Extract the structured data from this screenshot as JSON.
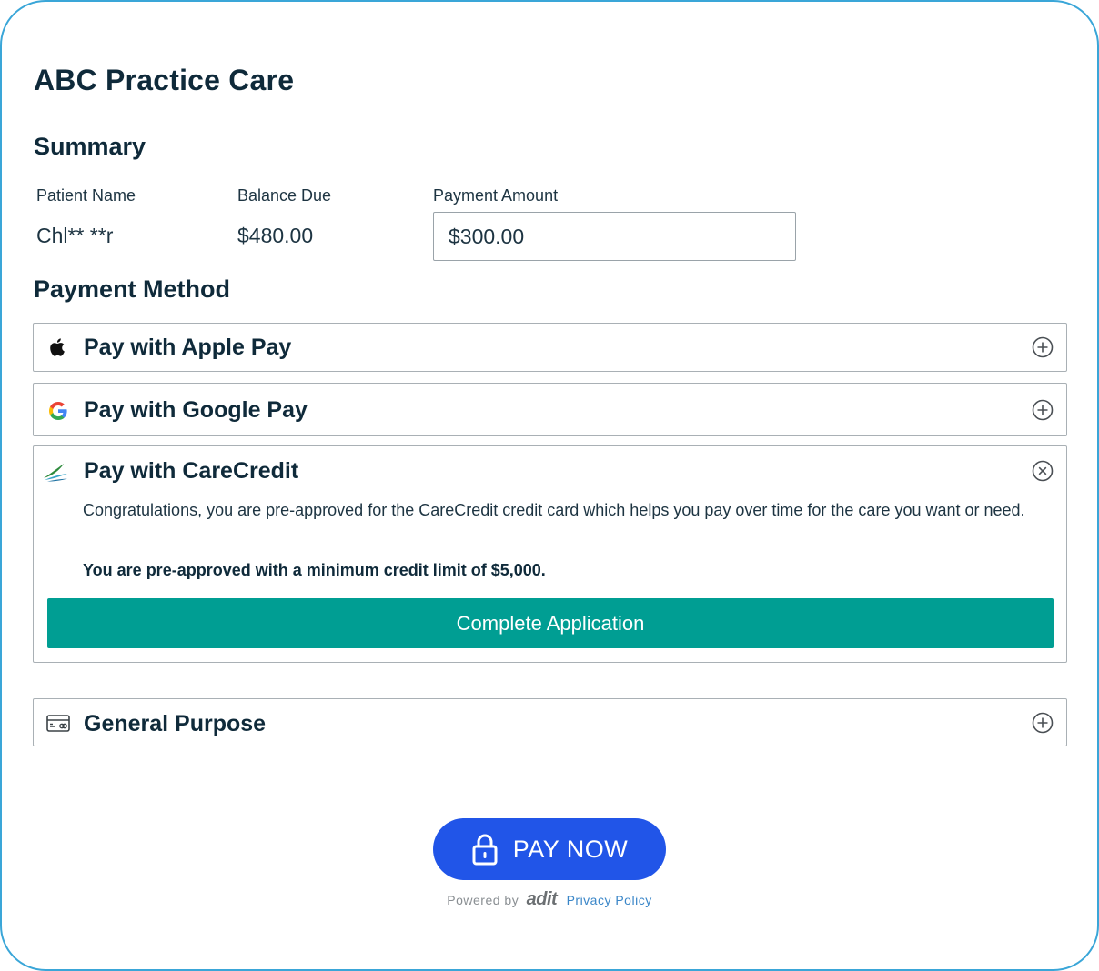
{
  "practice_name": "ABC Practice Care",
  "summary": {
    "heading": "Summary",
    "patient_name_label": "Patient Name",
    "patient_name_value": "Chl** **r",
    "balance_due_label": "Balance Due",
    "balance_due_value": "$480.00",
    "payment_amount_label": "Payment Amount",
    "payment_amount_value": "$300.00"
  },
  "payment_method": {
    "heading": "Payment Method",
    "options": [
      {
        "label": "Pay with Apple Pay",
        "icon": "apple-icon",
        "state": "collapsed"
      },
      {
        "label": "Pay with Google Pay",
        "icon": "google-icon",
        "state": "collapsed"
      },
      {
        "label": "Pay with CareCredit",
        "icon": "carecredit-icon",
        "state": "expanded"
      },
      {
        "label": "General Purpose",
        "icon": "credit-card-icon",
        "state": "collapsed"
      }
    ],
    "carecredit": {
      "message": "Congratulations, you are pre-approved for the CareCredit credit card which helps you pay over time for the care you want or need.",
      "preapproval": "You are pre-approved with a minimum credit limit of $5,000.",
      "button_label": "Complete Application"
    }
  },
  "pay_now_label": "PAY NOW",
  "footer": {
    "powered_by": "Powered by",
    "brand": "adit",
    "privacy_link": "Privacy Policy"
  },
  "colors": {
    "frame_border": "#3aa6d8",
    "primary_button": "#2155e8",
    "carecredit_button": "#009e93",
    "text_dark": "#0f2a3a"
  }
}
